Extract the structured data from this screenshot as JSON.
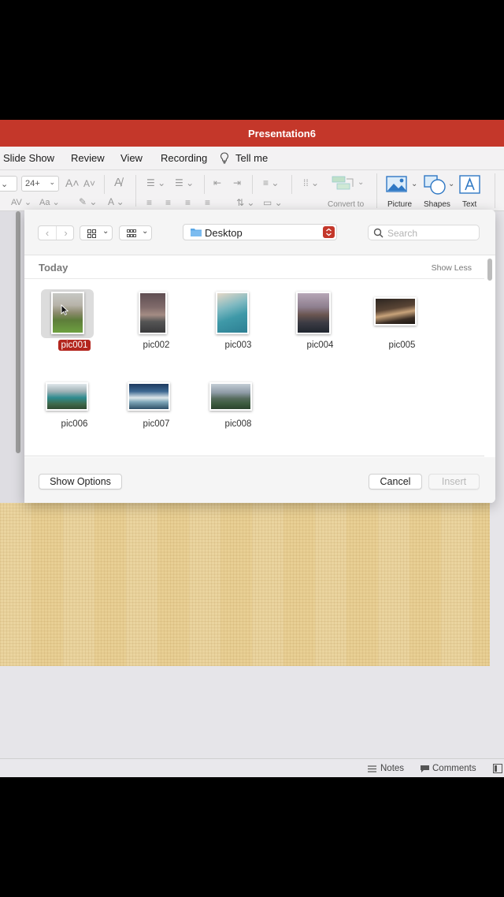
{
  "window": {
    "title": "Presentation6"
  },
  "menubar": {
    "items": [
      "Slide Show",
      "Review",
      "View",
      "Recording"
    ],
    "tell_me": "Tell me"
  },
  "ribbon": {
    "font_size": "24+",
    "labels": {
      "convert": "Convert to",
      "picture": "Picture",
      "shapes": "Shapes",
      "text": "Text"
    }
  },
  "dialog": {
    "location": "Desktop",
    "search_placeholder": "Search",
    "section_title": "Today",
    "show_less": "Show Less",
    "files": [
      "pic001",
      "pic002",
      "pic003",
      "pic004",
      "pic005",
      "pic006",
      "pic007",
      "pic008"
    ],
    "selected": "pic001",
    "show_options": "Show Options",
    "cancel": "Cancel",
    "insert": "Insert"
  },
  "statusbar": {
    "notes": "Notes",
    "comments": "Comments"
  },
  "colors": {
    "accent": "#c4372a",
    "selection": "#b3261e",
    "slide_bg": "#e8cf94"
  }
}
